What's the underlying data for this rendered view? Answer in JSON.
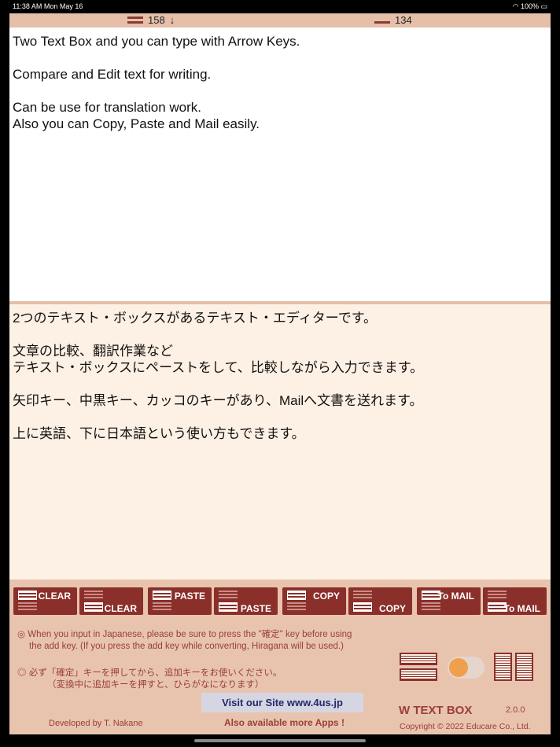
{
  "status_bar": {
    "time_date": "11:38 AM   Mon May 16",
    "battery": "100%"
  },
  "top_bar": {
    "upper_count": "158",
    "arrow": "↓",
    "lower_count": "134"
  },
  "upper_text": [
    "Two Text Box and you can type with Arrow Keys.",
    "",
    "Compare and Edit text for writing.",
    "",
    "Can be use for translation work.",
    "Also you can Copy, Paste and Mail easily."
  ],
  "lower_text": [
    "2つのテキスト・ボックスがあるテキスト・エディターです。",
    "",
    "文章の比較、翻訳作業など",
    "テキスト・ボックスにペーストをして、比較しながら入力できます。",
    "",
    "矢印キー、中黒キー、カッコのキーがあり、Mailへ文書を送れます。",
    "",
    "上に英語、下に日本語という使い方もできます。"
  ],
  "buttons": [
    {
      "label": "CLEAR",
      "target": "upper"
    },
    {
      "label": "CLEAR",
      "target": "lower"
    },
    {
      "label": "PASTE",
      "target": "upper"
    },
    {
      "label": "PASTE",
      "target": "lower"
    },
    {
      "label": "COPY",
      "target": "upper"
    },
    {
      "label": "COPY",
      "target": "lower"
    },
    {
      "label": "To MAIL",
      "target": "upper"
    },
    {
      "label": "To MAIL",
      "target": "lower"
    }
  ],
  "notes": {
    "en_line1": "◎ When you input in Japanese, please be sure to press the \"確定\" key before using",
    "en_line2": "the add key. (If you press the add key while converting, Hiragana will be used.)",
    "jp_line1": "◎ 必ず「確定」キーを押してから、追加キーをお使いください。",
    "jp_line2": "（変換中に追加キーを押すと、ひらがなになります）"
  },
  "footer": {
    "visit": "Visit our Site www.4us.jp",
    "more_apps": "Also available more Apps !",
    "developer": "Developed by T. Nakane",
    "app_name": "W TEXT BOX",
    "version": "2.0.0",
    "copyright": "Copyright © 2022 Educare Co., Ltd."
  },
  "colors": {
    "accent": "#8b2f2a",
    "toggle_knob": "#f0a04b",
    "lower_pane_bg": "#fdf0e4",
    "panel_bg": "#e8c4ae"
  }
}
